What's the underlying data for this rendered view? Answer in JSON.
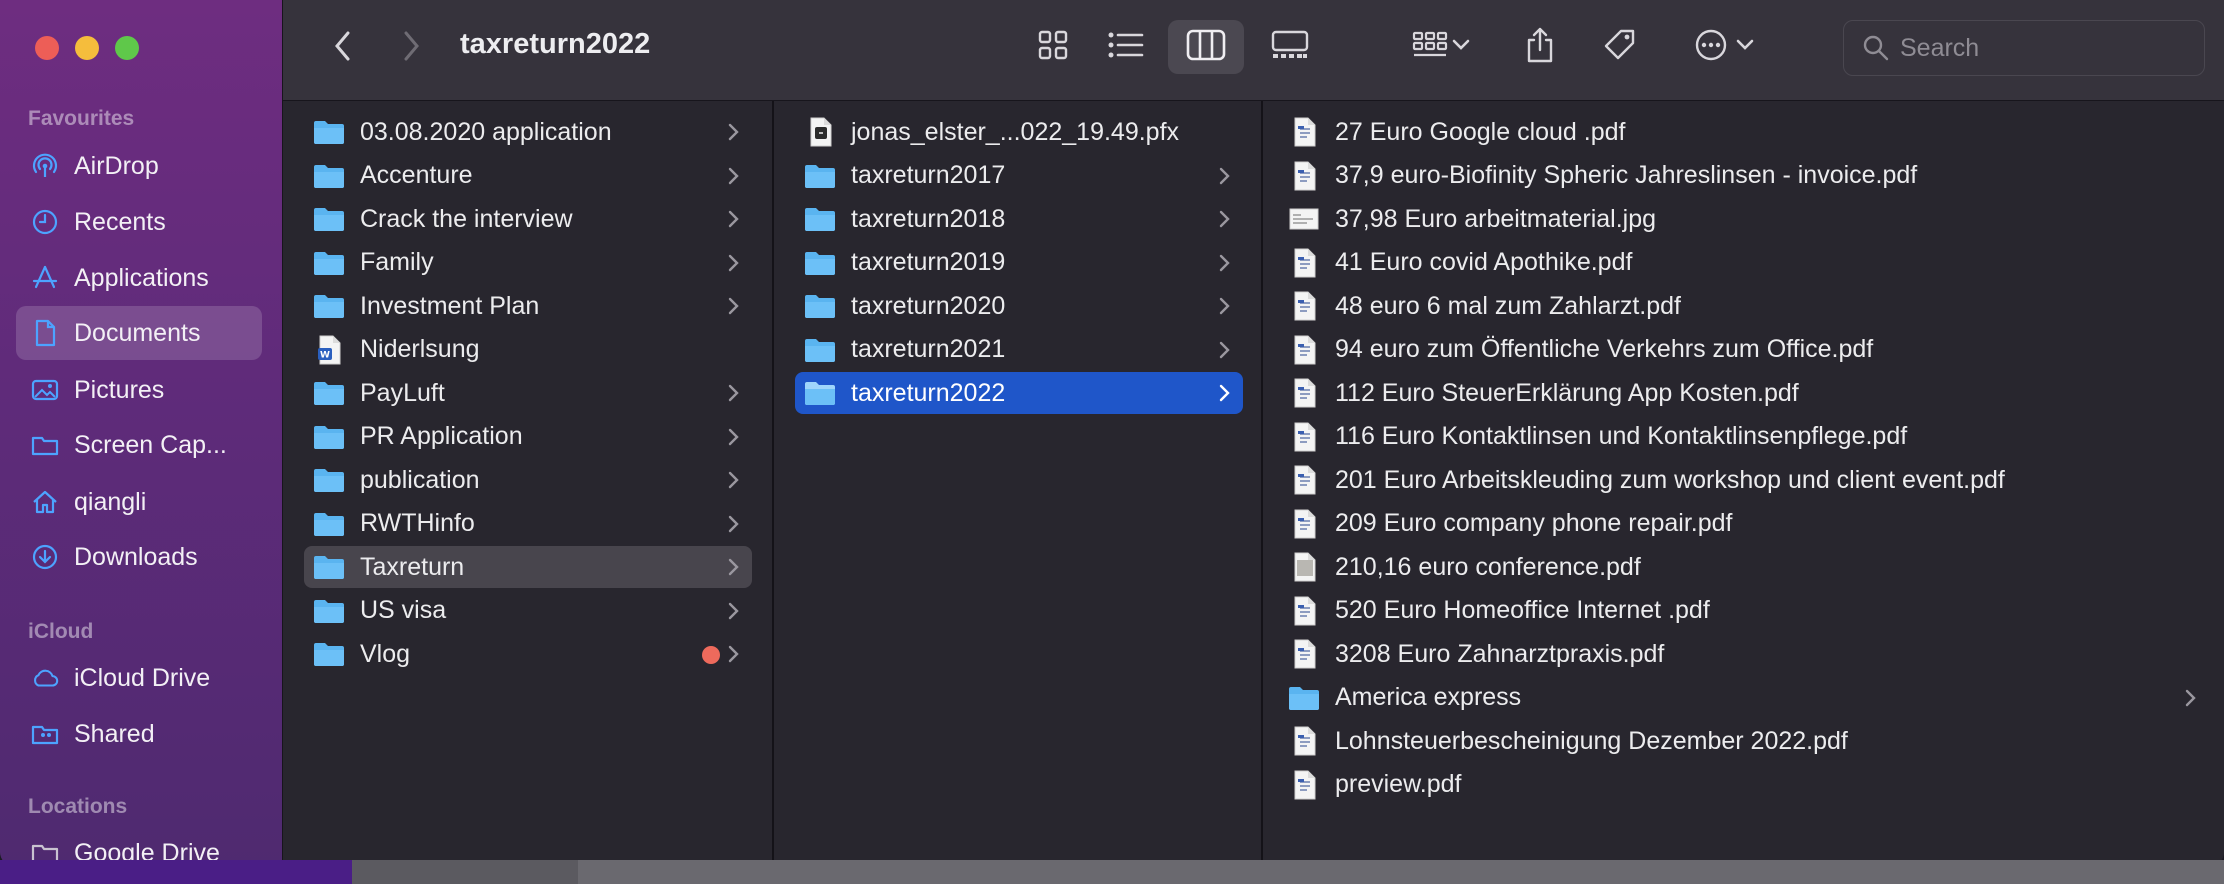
{
  "window": {
    "title": "taxreturn2022",
    "search_placeholder": "Search"
  },
  "sidebar": {
    "sections": {
      "favourites": "Favourites",
      "icloud": "iCloud",
      "locations": "Locations"
    },
    "items": [
      {
        "label": "AirDrop",
        "icon": "airdrop-icon"
      },
      {
        "label": "Recents",
        "icon": "clock-icon"
      },
      {
        "label": "Applications",
        "icon": "applications-icon"
      },
      {
        "label": "Documents",
        "icon": "document-icon",
        "selected": true
      },
      {
        "label": "Pictures",
        "icon": "photo-icon"
      },
      {
        "label": "Screen Cap...",
        "icon": "folder-outline-icon"
      },
      {
        "label": "qiangli",
        "icon": "home-icon"
      },
      {
        "label": "Downloads",
        "icon": "download-icon"
      },
      {
        "label": "iCloud Drive",
        "icon": "cloud-icon"
      },
      {
        "label": "Shared",
        "icon": "shared-folder-icon"
      },
      {
        "label": "Google Drive",
        "icon": "folder-outline-icon"
      }
    ]
  },
  "column1": [
    {
      "name": "03.08.2020 application",
      "type": "folder"
    },
    {
      "name": "Accenture",
      "type": "folder"
    },
    {
      "name": "Crack the interview",
      "type": "folder"
    },
    {
      "name": "Family",
      "type": "folder"
    },
    {
      "name": "Investment Plan",
      "type": "folder"
    },
    {
      "name": "Niderlsung",
      "type": "word"
    },
    {
      "name": "PayLuft",
      "type": "folder"
    },
    {
      "name": "PR Application",
      "type": "folder"
    },
    {
      "name": "publication",
      "type": "folder"
    },
    {
      "name": "RWTHinfo",
      "type": "folder"
    },
    {
      "name": "Taxreturn",
      "type": "folder",
      "selected": true
    },
    {
      "name": "US visa",
      "type": "folder"
    },
    {
      "name": "Vlog",
      "type": "folder",
      "tag": "red"
    }
  ],
  "column2": [
    {
      "name": "jonas_elster_...022_19.49.pfx",
      "type": "pfx"
    },
    {
      "name": "taxreturn2017",
      "type": "folder"
    },
    {
      "name": "taxreturn2018",
      "type": "folder"
    },
    {
      "name": "taxreturn2019",
      "type": "folder"
    },
    {
      "name": "taxreturn2020",
      "type": "folder"
    },
    {
      "name": "taxreturn2021",
      "type": "folder"
    },
    {
      "name": "taxreturn2022",
      "type": "folder",
      "selected": true
    }
  ],
  "column3": [
    {
      "name": "27 Euro Google cloud .pdf",
      "type": "pdf"
    },
    {
      "name": "37,9 euro-Biofinity Spheric Jahreslinsen - invoice.pdf",
      "type": "pdf"
    },
    {
      "name": "37,98 Euro arbeitmaterial.jpg",
      "type": "jpg"
    },
    {
      "name": "41 Euro covid Apothike.pdf",
      "type": "pdf"
    },
    {
      "name": "48 euro 6 mal zum Zahlarzt.pdf",
      "type": "pdf"
    },
    {
      "name": "94 euro zum Öffentliche Verkehrs zum Office.pdf",
      "type": "pdf"
    },
    {
      "name": "112 Euro SteuerErklärung App Kosten.pdf",
      "type": "pdf"
    },
    {
      "name": "116 Euro Kontaktlinsen und Kontaktlinsenpflege.pdf",
      "type": "pdf"
    },
    {
      "name": "201 Euro Arbeitskleuding zum workshop und client event.pdf",
      "type": "pdf"
    },
    {
      "name": "209 Euro company phone repair.pdf",
      "type": "pdf"
    },
    {
      "name": "210,16 euro conference.pdf",
      "type": "pdf-scan"
    },
    {
      "name": "520 Euro Homeoffice Internet .pdf",
      "type": "pdf"
    },
    {
      "name": "3208 Euro Zahnarztpraxis.pdf",
      "type": "pdf"
    },
    {
      "name": "America express",
      "type": "folder"
    },
    {
      "name": "Lohnsteuerbescheinigung Dezember 2022.pdf",
      "type": "pdf"
    },
    {
      "name": "preview.pdf",
      "type": "pdf"
    }
  ],
  "colors": {
    "accent": "#1f56c9",
    "folder_blue": "#5ab4f0",
    "sidebar_icon": "#4da3ff",
    "tag_red": "#ee6a5c"
  }
}
